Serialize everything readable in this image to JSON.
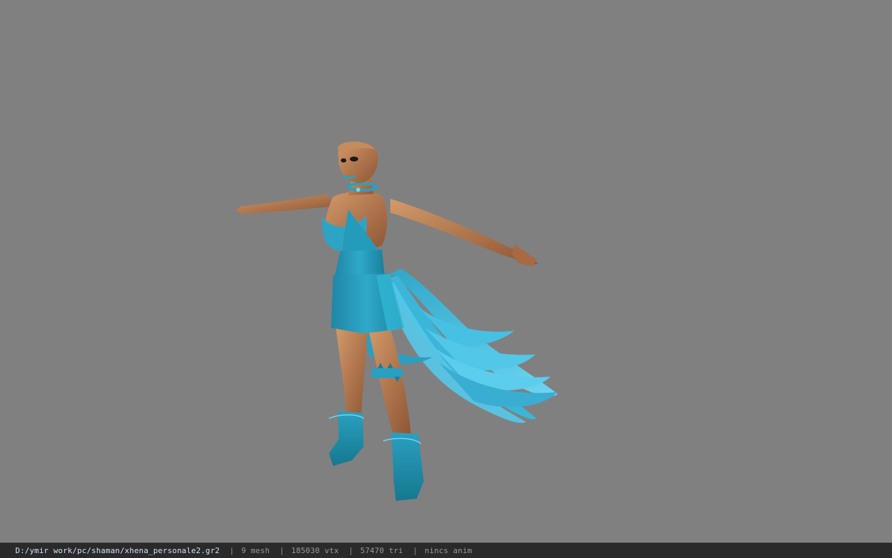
{
  "viewer": {
    "background_color": "#808080",
    "model": {
      "description_icon": "character-model-icon",
      "skin_color": "#b8794e",
      "outfit_color": "#2a9fbf",
      "feather_color": "#4cc3e6"
    }
  },
  "status_bar": {
    "file_path": "D:/ymir work/pc/shaman/xhena_personale2.gr2",
    "separator": "|",
    "mesh_count": "9 mesh",
    "vertex_count": "185030 vtx",
    "triangle_count": "57470 tri",
    "animation": "nincs anim"
  }
}
